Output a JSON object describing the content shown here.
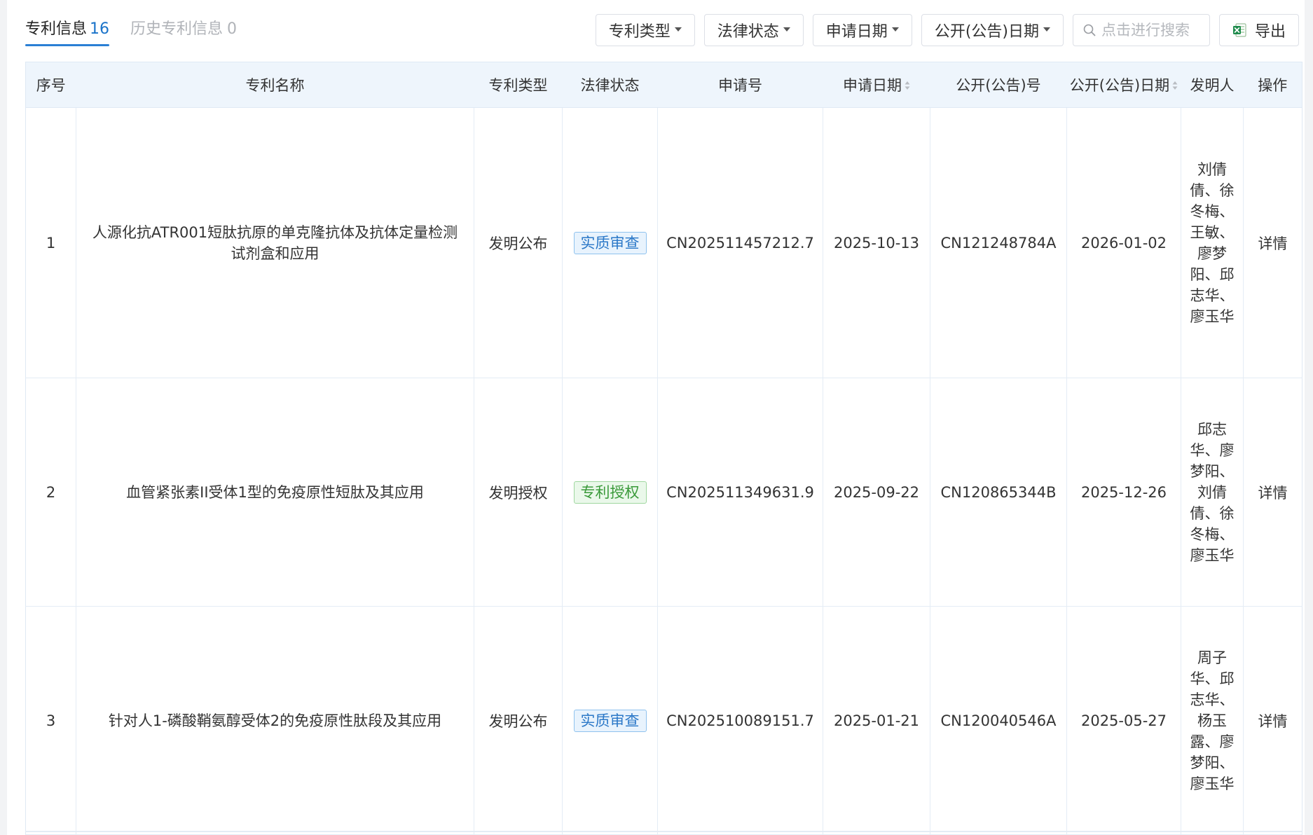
{
  "tabs": [
    {
      "label": "专利信息",
      "count": "16",
      "active": true
    },
    {
      "label": "历史专利信息",
      "count": "0",
      "active": false
    }
  ],
  "toolbar": {
    "filters": [
      {
        "label": "专利类型"
      },
      {
        "label": "法律状态"
      },
      {
        "label": "申请日期"
      },
      {
        "label": "公开(公告)日期"
      }
    ],
    "search_placeholder": "点击进行搜索",
    "export_label": "导出"
  },
  "table": {
    "columns": [
      "序号",
      "专利名称",
      "专利类型",
      "法律状态",
      "申请号",
      "申请日期",
      "公开(公告)号",
      "公开(公告)日期",
      "发明人",
      "操作"
    ],
    "rows": [
      {
        "index": "1",
        "name": "人源化抗ATR001短肽抗原的单克隆抗体及抗体定量检测试剂盒和应用",
        "type": "发明公布",
        "status": "实质审查",
        "application_no": "CN202511457212.7",
        "application_date": "2025-10-13",
        "publication_no": "CN121248784A",
        "publication_date": "2026-01-02",
        "inventors": "刘倩倩、徐冬梅、王敏、廖梦阳、邱志华、廖玉华",
        "action": "详情"
      },
      {
        "index": "2",
        "name": "血管紧张素II受体1型的免疫原性短肽及其应用",
        "type": "发明授权",
        "status": "专利授权",
        "application_no": "CN202511349631.9",
        "application_date": "2025-09-22",
        "publication_no": "CN120865344B",
        "publication_date": "2025-12-26",
        "inventors": "邱志华、廖梦阳、刘倩倩、徐冬梅、廖玉华",
        "action": "详情"
      },
      {
        "index": "3",
        "name": "针对人1-磷酸鞘氨醇受体2的免疫原性肽段及其应用",
        "type": "发明公布",
        "status": "实质审查",
        "application_no": "CN202510089151.7",
        "application_date": "2025-01-21",
        "publication_no": "CN120040546A",
        "publication_date": "2025-05-27",
        "inventors": "周子华、邱志华、杨玉露、廖梦阳、廖玉华",
        "action": "详情"
      }
    ]
  },
  "colors": {
    "accent": "#2b78c8",
    "header_bg": "#eef5fc",
    "tag_review_bg": "#e8f3fd",
    "tag_review_border": "#8fc2ee",
    "tag_review_text": "#2b78c8",
    "tag_grant_bg": "#eaf8ea",
    "tag_grant_border": "#9fd79f",
    "tag_grant_text": "#3a9a3a"
  }
}
